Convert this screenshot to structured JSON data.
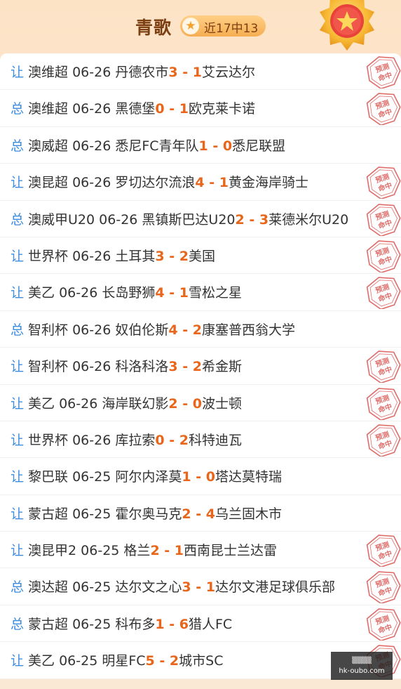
{
  "header": {
    "title": "青歌",
    "badge_text": "近17中13"
  },
  "colors": {
    "tag": "#3c8de0",
    "score": "#e8651a",
    "stamp": "#d9534f",
    "title": "#7b3f12"
  },
  "stamp_text": {
    "top": "预测",
    "bottom": "命中"
  },
  "rows": [
    {
      "tag": "让",
      "league": "澳维超",
      "date": "06-26",
      "home": "丹德农市",
      "home_score": "3",
      "sep": " - ",
      "away_score": "1",
      "away": "艾云达尔",
      "hit": true
    },
    {
      "tag": "总",
      "league": "澳维超",
      "date": "06-26",
      "home": "黑德堡",
      "home_score": "0",
      "sep": " - ",
      "away_score": "1",
      "away": "欧克莱卡诺",
      "hit": true
    },
    {
      "tag": "总",
      "league": "澳威超",
      "date": "06-26",
      "home": "悉尼FC青年队",
      "home_score": "1",
      "sep": " - ",
      "away_score": "0",
      "away": "悉尼联盟",
      "hit": false
    },
    {
      "tag": "让",
      "league": "澳昆超",
      "date": "06-26",
      "home": "罗切达尔流浪",
      "home_score": "4",
      "sep": " - ",
      "away_score": "1",
      "away": "黄金海岸骑士",
      "hit": true
    },
    {
      "tag": "总",
      "league": "澳威甲U20",
      "date": "06-26",
      "home": "黑镇斯巴达U20",
      "home_score": "2",
      "sep": " - ",
      "away_score": "3",
      "away": "莱德米尔U20",
      "hit": true
    },
    {
      "tag": "让",
      "league": "世界杯",
      "date": "06-26",
      "home": "土耳其",
      "home_score": "3",
      "sep": " - ",
      "away_score": "2",
      "away": "美国",
      "hit": true
    },
    {
      "tag": "让",
      "league": "美乙",
      "date": "06-26",
      "home": "长岛野狮",
      "home_score": "4",
      "sep": " - ",
      "away_score": "1",
      "away": "雪松之星",
      "hit": true
    },
    {
      "tag": "总",
      "league": "智利杯",
      "date": "06-26",
      "home": "奴伯伦斯",
      "home_score": "4",
      "sep": " - ",
      "away_score": "2",
      "away": "康塞普西翁大学",
      "hit": false
    },
    {
      "tag": "让",
      "league": "智利杯",
      "date": "06-26",
      "home": "科洛科洛",
      "home_score": "3",
      "sep": " - ",
      "away_score": "2",
      "away": "希金斯",
      "hit": true
    },
    {
      "tag": "让",
      "league": "美乙",
      "date": "06-26",
      "home": "海岸联幻影",
      "home_score": "2",
      "sep": " - ",
      "away_score": "0",
      "away": "波士顿",
      "hit": true
    },
    {
      "tag": "让",
      "league": "世界杯",
      "date": "06-26",
      "home": "库拉索",
      "home_score": "0",
      "sep": " - ",
      "away_score": "2",
      "away": "科特迪瓦",
      "hit": true
    },
    {
      "tag": "让",
      "league": "黎巴联",
      "date": "06-25",
      "home": "阿尔内泽莫",
      "home_score": "1",
      "sep": " - ",
      "away_score": "0",
      "away": "塔达莫特瑞",
      "hit": false
    },
    {
      "tag": "让",
      "league": "蒙古超",
      "date": "06-25",
      "home": "霍尔奥马克",
      "home_score": "2",
      "sep": " - ",
      "away_score": "4",
      "away": "乌兰固木市",
      "hit": false
    },
    {
      "tag": "让",
      "league": "澳昆甲2",
      "date": "06-25",
      "home": "格兰",
      "home_score": "2",
      "sep": " - ",
      "away_score": "1",
      "away": "西南昆士兰达雷",
      "hit": true
    },
    {
      "tag": "总",
      "league": "澳达超",
      "date": "06-25",
      "home": "达尔文之心",
      "home_score": "3",
      "sep": " - ",
      "away_score": "1",
      "away": "达尔文港足球俱乐部",
      "hit": true
    },
    {
      "tag": "总",
      "league": "蒙古超",
      "date": "06-25",
      "home": "科布多",
      "home_score": "1",
      "sep": " - ",
      "away_score": "6",
      "away": "猎人FC",
      "hit": true
    },
    {
      "tag": "让",
      "league": "美乙",
      "date": "06-25",
      "home": "明星FC",
      "home_score": "5",
      "sep": " - ",
      "away_score": "2",
      "away": "城市SC",
      "hit": true
    }
  ],
  "watermark": {
    "top": "▒▒▒▒",
    "bottom": "hk-oubo.com"
  }
}
